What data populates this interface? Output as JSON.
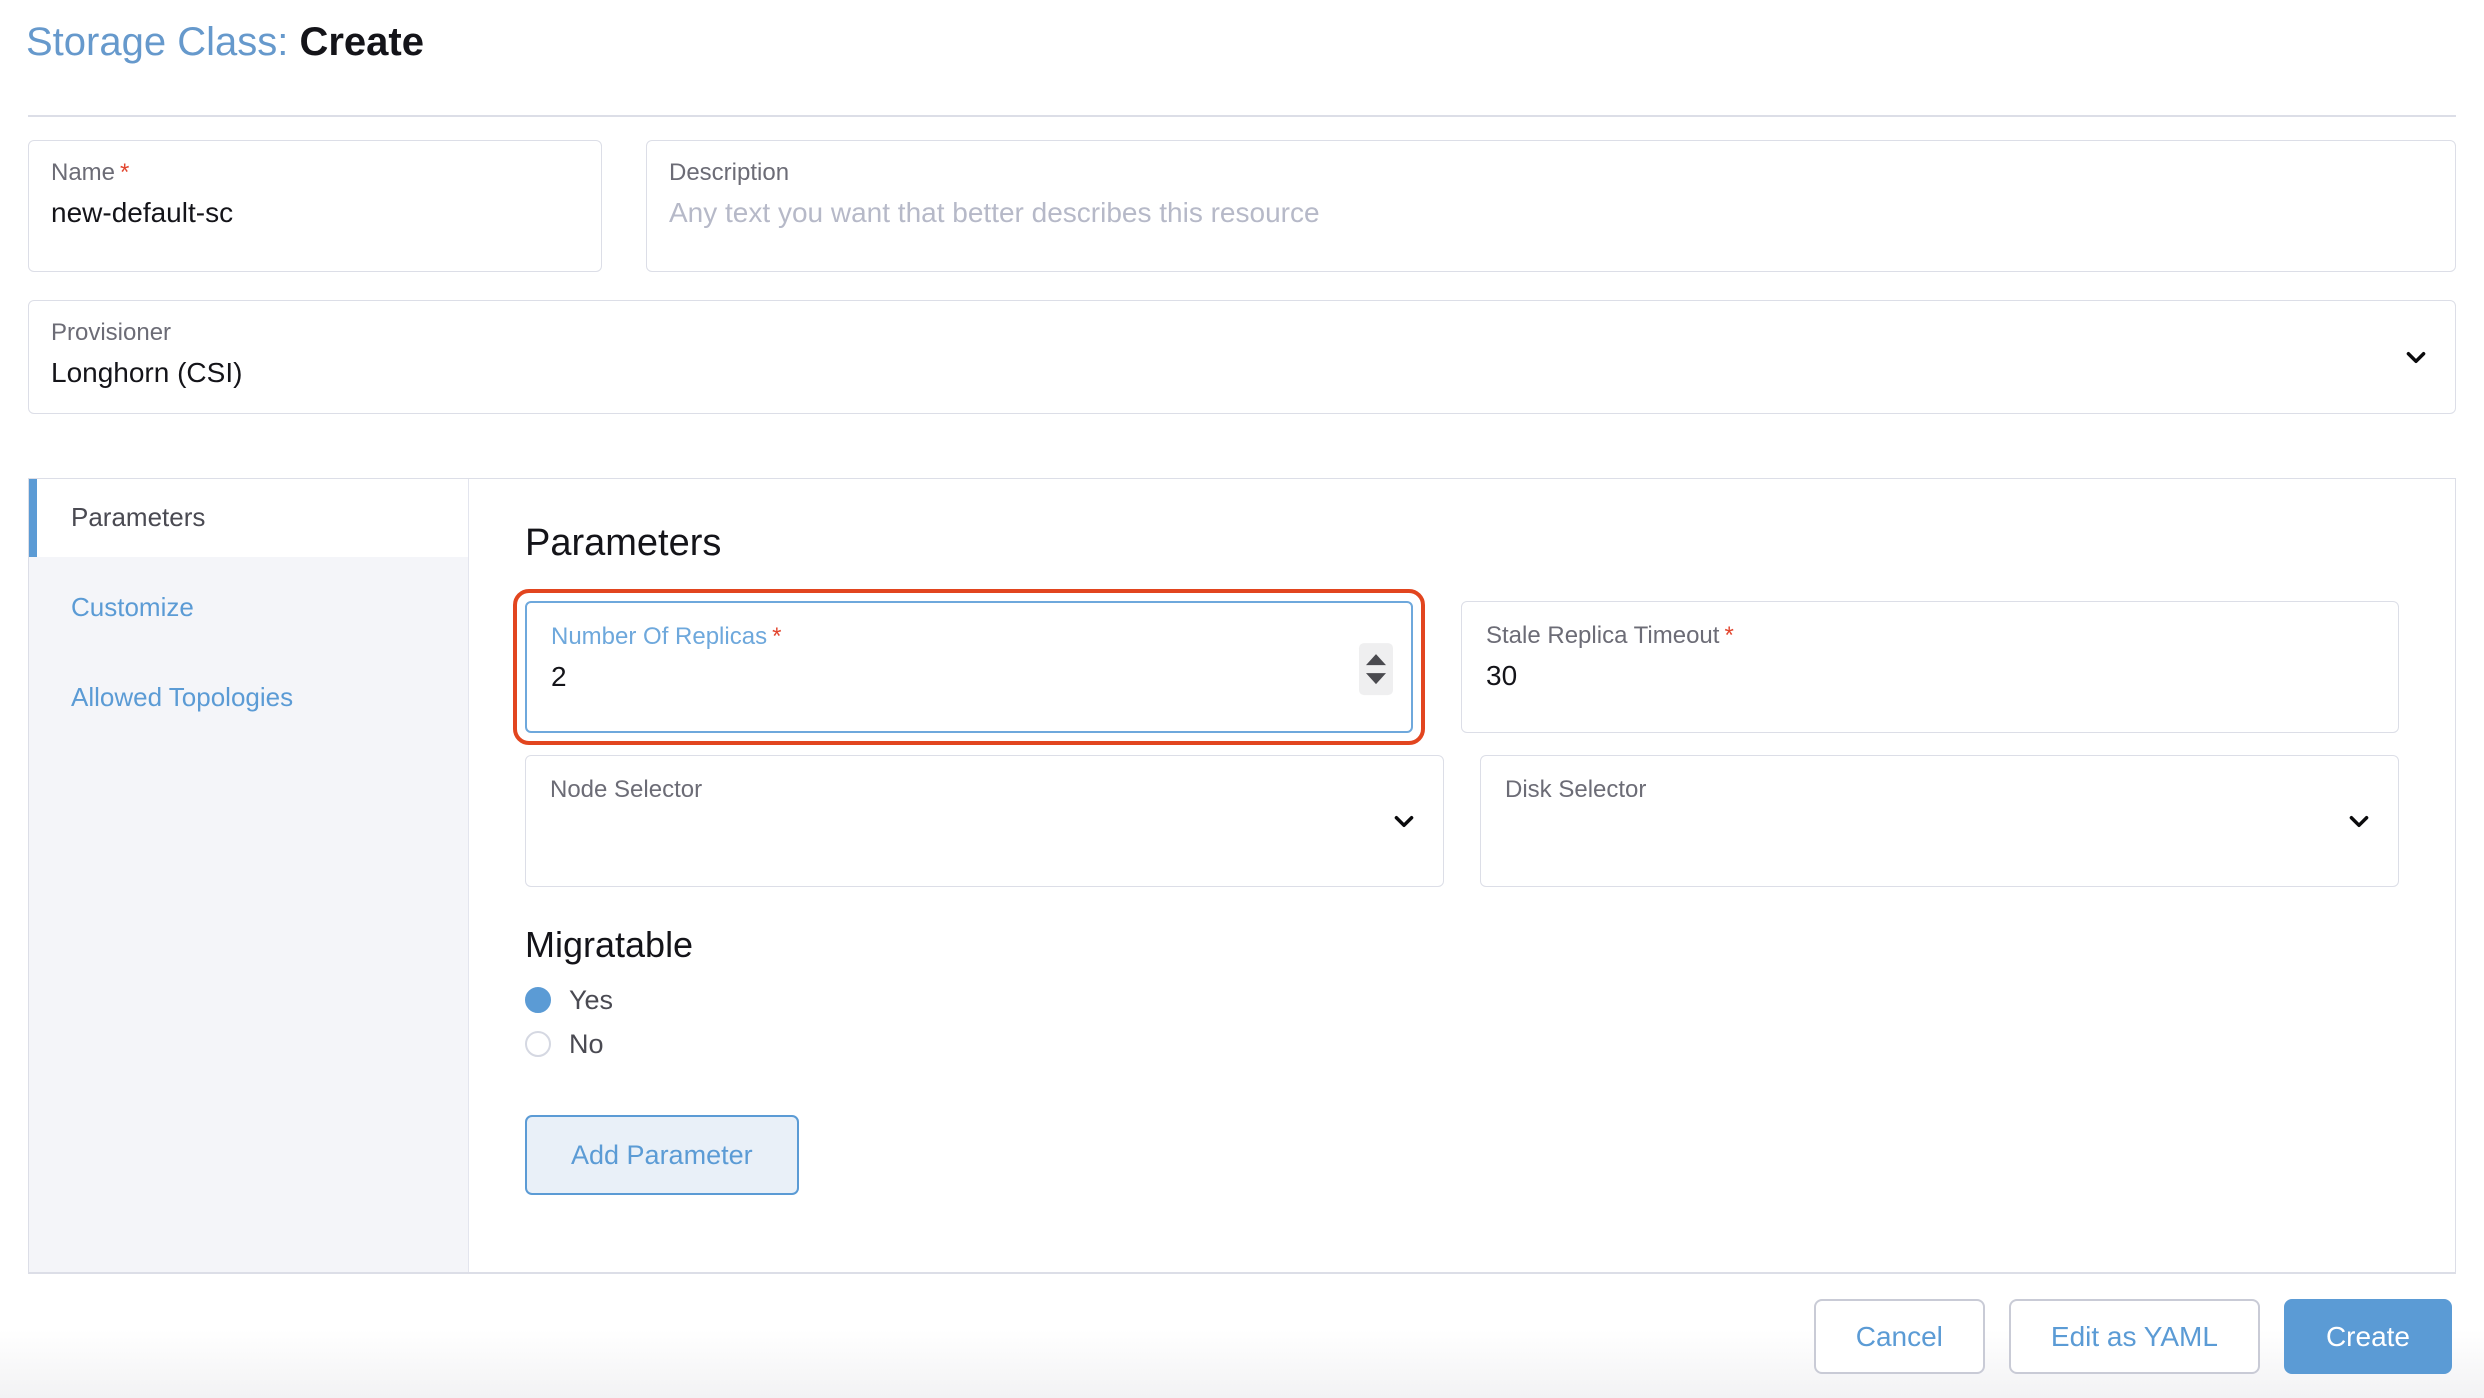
{
  "header": {
    "title_prefix": "Storage Class:",
    "title_suffix": "Create"
  },
  "form": {
    "name": {
      "label": "Name",
      "required_mark": "*",
      "value": "new-default-sc"
    },
    "description": {
      "label": "Description",
      "placeholder": "Any text you want that better describes this resource",
      "value": ""
    },
    "provisioner": {
      "label": "Provisioner",
      "value": "Longhorn (CSI)",
      "chevron_icon": "chevron-down-icon"
    }
  },
  "tabs": [
    {
      "label": "Parameters",
      "active": true
    },
    {
      "label": "Customize",
      "active": false
    },
    {
      "label": "Allowed Topologies",
      "active": false
    }
  ],
  "parameters_panel": {
    "section_title": "Parameters",
    "fields": [
      {
        "label": "Number Of Replicas",
        "required_mark": "*",
        "value": "2",
        "type": "number",
        "focused": true,
        "highlighted": true
      },
      {
        "label": "Stale Replica Timeout",
        "required_mark": "*",
        "value": "30",
        "type": "number",
        "focused": false,
        "highlighted": false
      },
      {
        "label": "Node Selector",
        "required_mark": "",
        "value": "",
        "type": "select",
        "focused": false,
        "highlighted": false
      },
      {
        "label": "Disk Selector",
        "required_mark": "",
        "value": "",
        "type": "select",
        "focused": false,
        "highlighted": false
      }
    ],
    "migratable": {
      "title": "Migratable",
      "options": [
        {
          "label": "Yes",
          "selected": true
        },
        {
          "label": "No",
          "selected": false
        }
      ]
    },
    "add_parameter_label": "Add Parameter"
  },
  "footer": {
    "cancel_label": "Cancel",
    "edit_yaml_label": "Edit as YAML",
    "create_label": "Create"
  },
  "colors": {
    "accent_blue": "#5b9bd5",
    "title_blue": "#6699cc",
    "required_red": "#e2462f",
    "annotation_red": "#e2451f",
    "border_gray": "#dcdee7",
    "sidebar_bg": "#f4f5f9"
  }
}
